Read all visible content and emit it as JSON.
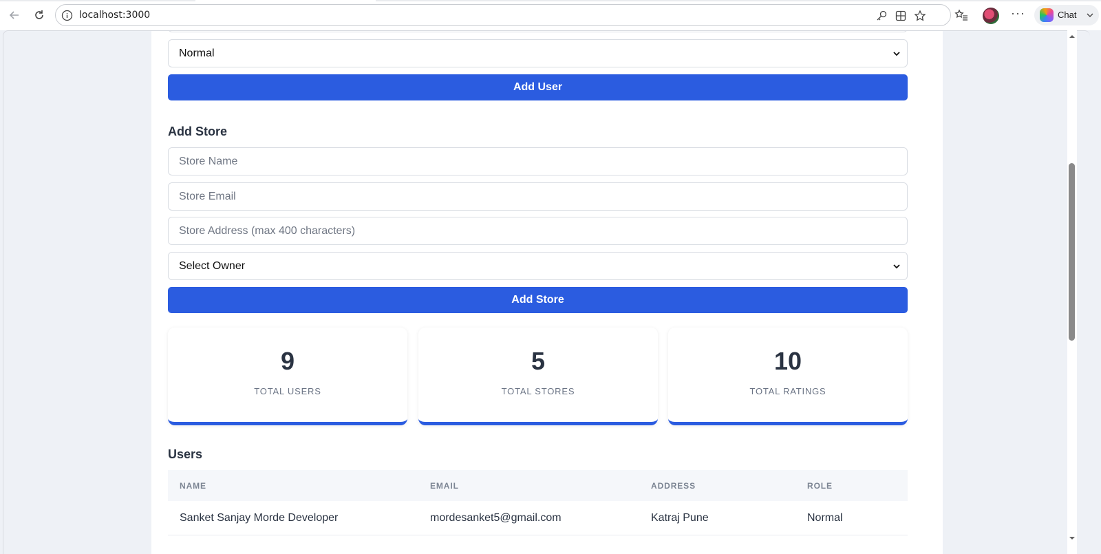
{
  "browser": {
    "url": "localhost:3000",
    "chat_label": "Chat"
  },
  "form_user": {
    "role_value": "Normal",
    "submit_label": "Add User"
  },
  "form_store": {
    "title": "Add Store",
    "name_placeholder": "Store Name",
    "email_placeholder": "Store Email",
    "address_placeholder": "Store Address (max 400 characters)",
    "owner_value": "Select Owner",
    "submit_label": "Add Store"
  },
  "stats": [
    {
      "value": "9",
      "label": "TOTAL USERS"
    },
    {
      "value": "5",
      "label": "TOTAL STORES"
    },
    {
      "value": "10",
      "label": "TOTAL RATINGS"
    }
  ],
  "users": {
    "title": "Users",
    "columns": [
      "NAME",
      "EMAIL",
      "ADDRESS",
      "ROLE"
    ],
    "rows": [
      [
        "Sanket Sanjay Morde Developer",
        "mordesanket5@gmail.com",
        "Katraj Pune",
        "Normal"
      ]
    ]
  },
  "colors": {
    "accent": "#2b5ce0",
    "heading": "#2a3342",
    "page_bg": "#eef1f6"
  }
}
